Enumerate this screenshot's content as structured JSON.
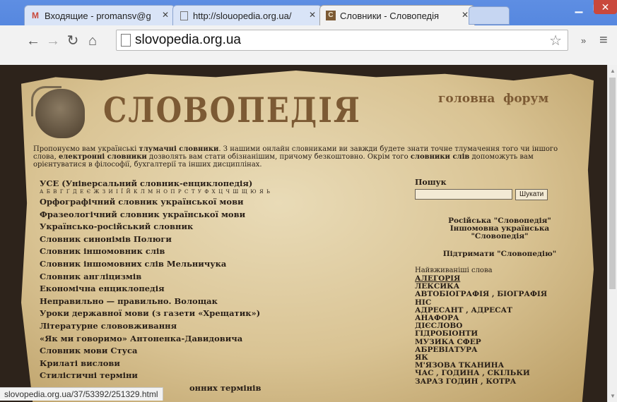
{
  "tabs": [
    {
      "label": "Входящие - promansv@g",
      "icon": "gmail-icon"
    },
    {
      "label": "http://slouopedia.org.ua/",
      "icon": "page-icon"
    },
    {
      "label": "Словники - Словопедія",
      "icon": "site-icon"
    }
  ],
  "address": "slovopedia.org.ua",
  "logo": "СЛОВОПЕДІЯ",
  "nav": {
    "home": "головна",
    "forum": "форум"
  },
  "intro": {
    "p1": "Пропонуємо вам українські ",
    "b1": "тлумачні словники",
    "p2": ". З нашими онлайн словниками ви завжди будете знати точне тлумачення того чи іншого слова, ",
    "b2": "електронні словники",
    "p3": " дозволять вам стати обізнанішим, причому безкоштовно. Окрім того ",
    "b3": "словники слів",
    "p4": " допоможуть вам орієнтуватися в філософії, бухгалтерії та інших дисциплінах."
  },
  "dictionaries": [
    "УСЕ (Універсальний словник-енциклопедія)",
    "Орфографічний словник української мови",
    "Фразеологічний словник української мови",
    "Українсько-російський словник",
    "Словник синонімів Полюги",
    "Словник іншомовник слів",
    "Словник іншомовних слів Мельничука",
    "Словник англіцизмів",
    "Економічна енциклопедія",
    "Неправильно — правильно. Волощак",
    "Уроки державної мови (з газети «Хрещатик»)",
    "Літературне слововживання",
    "«Як ми говоримо» Антоненка-Давидовича",
    "Словник мови Стуса",
    "Крилаті вислови",
    "Стилістичні терміни",
    "онних термінів"
  ],
  "alphabet": "А Б В Г Ґ Д Е Є Ж З И І Ї Й К Л М Н О П Р С Т У Ф Х Ц Ч Ш Щ Ю Я Ь",
  "sidebar": {
    "search_label": "Пошук",
    "search_button": "Шукати",
    "links": [
      "Російська \"Словопедія\"",
      "Іншомовна українська \"Словопедія\"",
      "Підтримати \"Словопедію\""
    ],
    "words_label": "Найвживаніші слова",
    "words": [
      "АЛЕГОРІЯ",
      "ЛЕКСИКА",
      "АВТОБІОГРАФІЯ , БІОГРАФІЯ",
      "НІС",
      "АДРЕСАНТ , АДРЕСАТ",
      "АНАФОРА",
      "ДІЄСЛОВО",
      "ГІДРОБІОНТИ",
      "МУЗИКА СФЕР",
      "АБРЕВІАТУРА",
      "ЯК",
      "М'ЯЗОВА ТКАНИНА",
      "ЧАС , ГОДИНА , СКІЛЬКИ",
      "ЗАРАЗ ГОДИН , КОТРА"
    ]
  },
  "status": "slovopedia.org.ua/37/53392/251329.html"
}
